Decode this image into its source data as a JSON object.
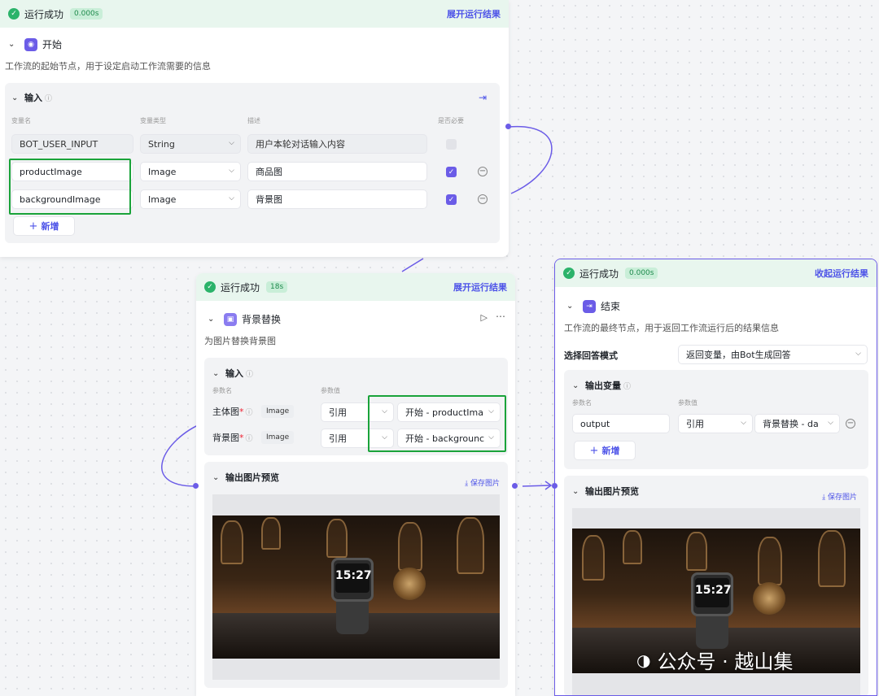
{
  "colors": {
    "accent": "#4d53e8",
    "success": "#2bb36a",
    "node": "#6b5ce7",
    "highlight": "#1aa33a"
  },
  "start_node": {
    "status": "运行成功",
    "time": "0.000s",
    "toggle": "展开运行结果",
    "title": "开始",
    "description": "工作流的起始节点，用于设定启动工作流需要的信息",
    "input_title": "输入",
    "columns": [
      "变量名",
      "变量类型",
      "描述",
      "是否必要"
    ],
    "rows": [
      {
        "name": "BOT_USER_INPUT",
        "type": "String",
        "desc": "用户本轮对话输入内容",
        "required": false
      },
      {
        "name": "productImage",
        "type": "Image",
        "desc": "商品图",
        "required": true
      },
      {
        "name": "backgroundImage",
        "type": "Image",
        "desc": "背景图",
        "required": true
      }
    ],
    "add_label": "新增"
  },
  "bg_node": {
    "status": "运行成功",
    "time": "18s",
    "toggle": "展开运行结果",
    "title": "背景替换",
    "description": "为图片替换背景图",
    "input_title": "输入",
    "col_param": "参数名",
    "col_value": "参数值",
    "params": [
      {
        "name": "主体图",
        "type": "Image",
        "mode": "引用",
        "ref": "开始 - productIma"
      },
      {
        "name": "背景图",
        "type": "Image",
        "mode": "引用",
        "ref": "开始 - backgrounc"
      }
    ],
    "preview_title": "输出图片预览",
    "save_label": "保存图片",
    "watch_time": "15:27"
  },
  "end_node": {
    "status": "运行成功",
    "time": "0.000s",
    "toggle": "收起运行结果",
    "title": "结束",
    "description": "工作流的最终节点，用于返回工作流运行后的结果信息",
    "answer_mode_label": "选择回答模式",
    "answer_mode_value": "返回变量，由Bot生成回答",
    "output_title": "输出变量",
    "col_param": "参数名",
    "col_value": "参数值",
    "output": {
      "name": "output",
      "mode": "引用",
      "ref": "背景替换 - da"
    },
    "add_label": "新增",
    "preview_title": "输出图片预览",
    "save_label": "保存图片",
    "watch_time": "15:27"
  },
  "watermark": "公众号 · 越山集"
}
